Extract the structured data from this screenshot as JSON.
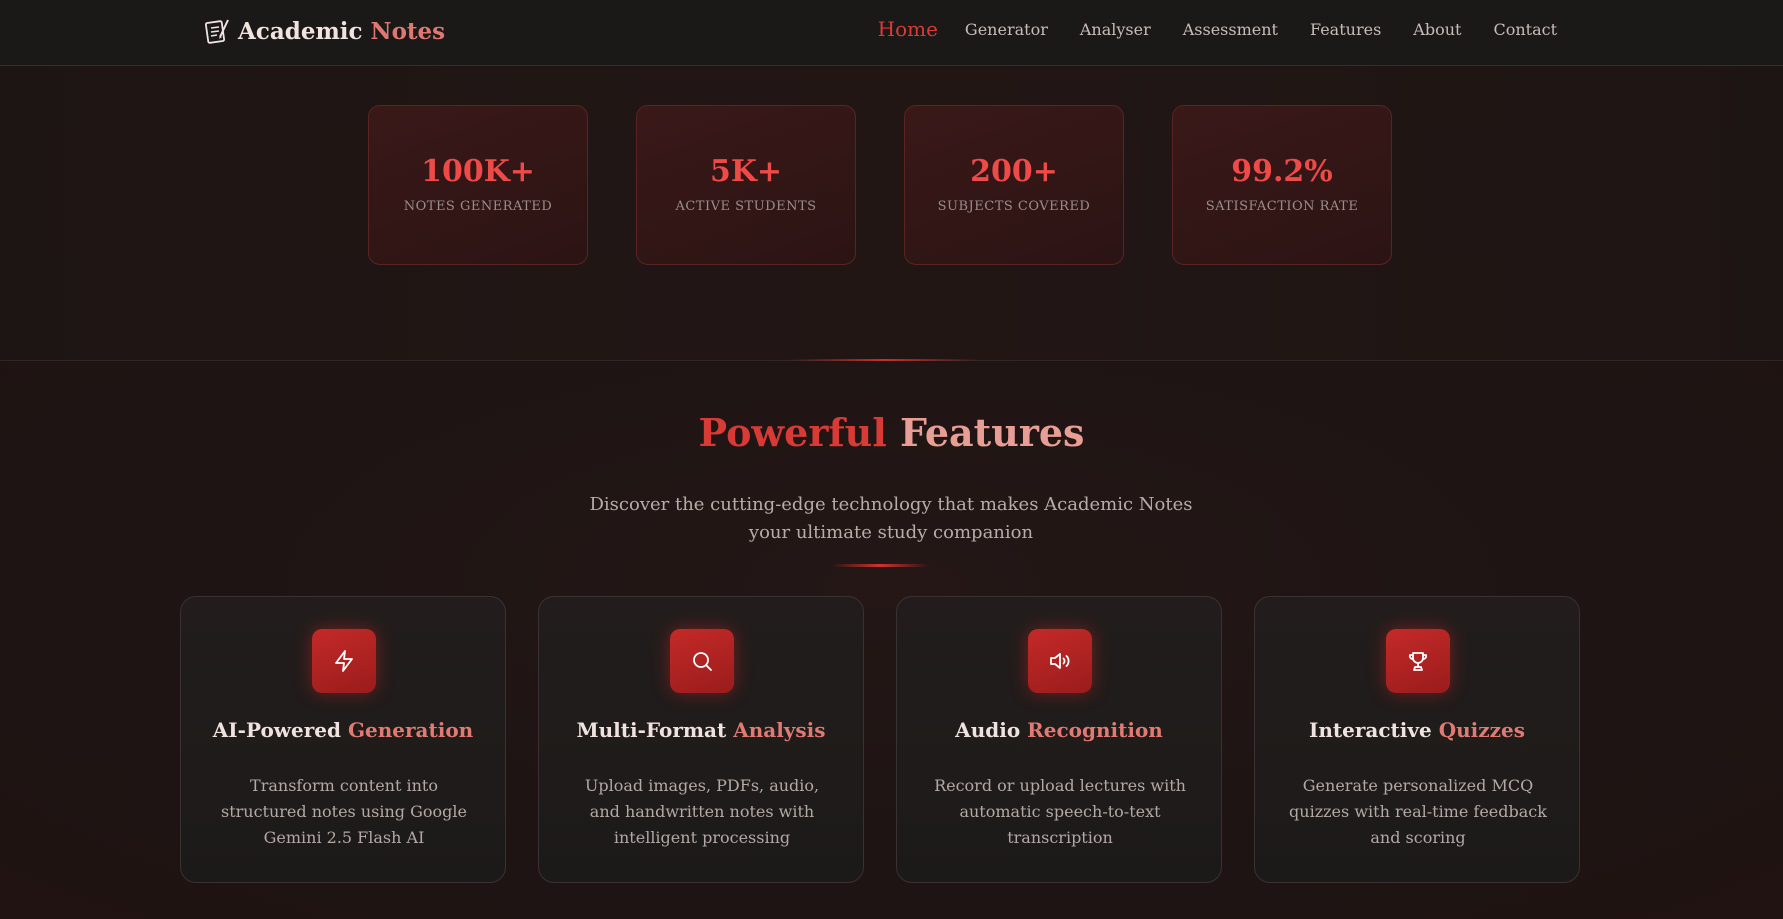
{
  "brand": {
    "word1": "Academic",
    "word2": "Notes",
    "icon": "notepad-icon"
  },
  "nav": {
    "items": [
      {
        "label": "Home",
        "active": true
      },
      {
        "label": "Generator"
      },
      {
        "label": "Analyser"
      },
      {
        "label": "Assessment"
      },
      {
        "label": "Features"
      },
      {
        "label": "About"
      },
      {
        "label": "Contact"
      }
    ]
  },
  "stats": [
    {
      "value": "100K+",
      "label": "NOTES GENERATED"
    },
    {
      "value": "5K+",
      "label": "ACTIVE STUDENTS"
    },
    {
      "value": "200+",
      "label": "SUBJECTS COVERED"
    },
    {
      "value": "99.2%",
      "label": "SATISFACTION RATE"
    }
  ],
  "features": {
    "title_part1": "Powerful",
    "title_part2": "Features",
    "subtitle": "Discover the cutting-edge technology that makes Academic Notes your ultimate study companion",
    "cards": [
      {
        "icon": "lightning-icon",
        "title_part1": "AI-Powered",
        "title_part2": "Generation",
        "description": "Transform content into structured notes using Google Gemini 2.5 Flash AI"
      },
      {
        "icon": "search-icon",
        "title_part1": "Multi-Format",
        "title_part2": "Analysis",
        "description": "Upload images, PDFs, audio, and handwritten notes with intelligent processing"
      },
      {
        "icon": "speaker-icon",
        "title_part1": "Audio",
        "title_part2": "Recognition",
        "description": "Record or upload lectures with automatic speech-to-text transcription"
      },
      {
        "icon": "trophy-icon",
        "title_part1": "Interactive",
        "title_part2": "Quizzes",
        "description": "Generate personalized MCQ quizzes with real-time feedback and scoring"
      }
    ]
  },
  "colors": {
    "accent": "#dc3a36",
    "stat_value": "#ee4a48",
    "background": "#1c1413"
  }
}
